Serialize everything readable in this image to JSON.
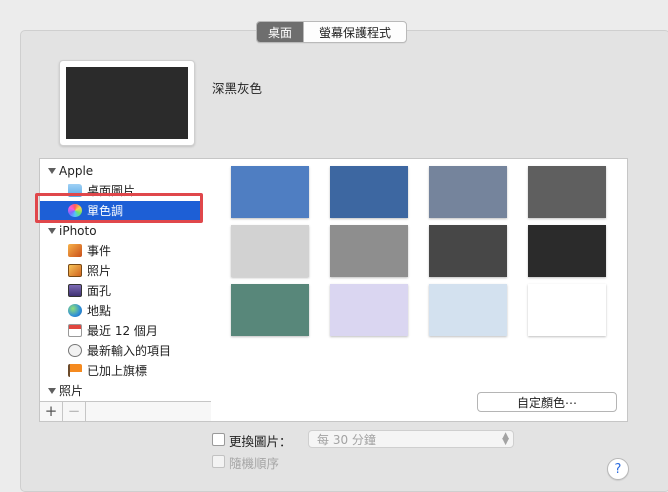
{
  "tabs": [
    {
      "label": "桌面",
      "selected": true
    },
    {
      "label": "螢幕保護程式",
      "selected": false
    }
  ],
  "preview": {
    "color_name": "深黑灰色",
    "color": "#2b2b2b"
  },
  "sidebar": {
    "groups": [
      {
        "label": "Apple",
        "expanded": true
      },
      {
        "label": "iPhoto",
        "expanded": true
      },
      {
        "label": "照片",
        "expanded": true
      }
    ],
    "items": [
      {
        "label": "桌面圖片",
        "icon": "folder-icon",
        "group": "Apple"
      },
      {
        "label": "單色調",
        "icon": "color-wheel-icon",
        "group": "Apple",
        "selected": true
      },
      {
        "label": "事件",
        "icon": "events-icon",
        "group": "iPhoto"
      },
      {
        "label": "照片",
        "icon": "photos-icon",
        "group": "iPhoto"
      },
      {
        "label": "面孔",
        "icon": "faces-icon",
        "group": "iPhoto"
      },
      {
        "label": "地點",
        "icon": "places-icon",
        "group": "iPhoto"
      },
      {
        "label": "最近 12 個月",
        "icon": "calendar-icon",
        "group": "iPhoto"
      },
      {
        "label": "最新輸入的項目",
        "icon": "import-icon",
        "group": "iPhoto"
      },
      {
        "label": "已加上旗標",
        "icon": "flag-icon",
        "group": "iPhoto"
      }
    ],
    "add_label": "+",
    "remove_label": "−"
  },
  "swatches": {
    "colors": [
      "#4f7ec2",
      "#3d67a1",
      "#75849c",
      "#5f5f5f",
      "#d2d2d2",
      "#8e8e8e",
      "#474747",
      "#2b2b2b",
      "#58877a",
      "#dad6f1",
      "#d3e1ef",
      "#ffffff"
    ],
    "selected": "#2b2b2b",
    "custom_label": "自定顏色⋯"
  },
  "options": {
    "change_picture_label": "更換圖片：",
    "change_picture_checked": false,
    "interval_value": "每 30 分鐘",
    "random_label": "隨機順序",
    "random_checked": false
  },
  "help_label": "?"
}
